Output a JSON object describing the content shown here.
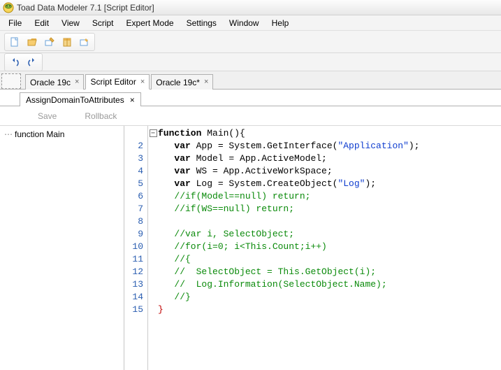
{
  "window": {
    "title": "Toad Data Modeler 7.1 [Script Editor]"
  },
  "menus": [
    "File",
    "Edit",
    "View",
    "Script",
    "Expert Mode",
    "Settings",
    "Window",
    "Help"
  ],
  "doc_tabs": [
    {
      "label": "Oracle 19c",
      "active": false,
      "closable": true
    },
    {
      "label": "Script Editor",
      "active": true,
      "closable": true
    },
    {
      "label": "Oracle 19c*",
      "active": false,
      "closable": true
    }
  ],
  "subtab": {
    "label": "AssignDomainToAttributes"
  },
  "actions": {
    "save": "Save",
    "rollback": "Rollback"
  },
  "tree": {
    "item": "function Main"
  },
  "code": {
    "lines": [
      {
        "n": null,
        "html": "<span class='kw'>function</span> Main(){"
      },
      {
        "n": 2,
        "html": "   <span class='kw'>var</span> App = System.GetInterface(<span class='str'>\"Application\"</span>);"
      },
      {
        "n": 3,
        "html": "   <span class='kw'>var</span> Model = App.ActiveModel;"
      },
      {
        "n": 4,
        "html": "   <span class='kw'>var</span> WS = App.ActiveWorkSpace;"
      },
      {
        "n": 5,
        "html": "   <span class='kw'>var</span> Log = System.CreateObject(<span class='str'>\"Log\"</span>);"
      },
      {
        "n": 6,
        "html": "   <span class='cm'>//if(Model==null) return;</span>"
      },
      {
        "n": 7,
        "html": "   <span class='cm'>//if(WS==null) return;</span>"
      },
      {
        "n": 8,
        "html": ""
      },
      {
        "n": 9,
        "html": "   <span class='cm'>//var i, SelectObject;</span>"
      },
      {
        "n": 10,
        "html": "   <span class='cm'>//for(i=0; i&lt;This.Count;i++)</span>"
      },
      {
        "n": 11,
        "html": "   <span class='cm'>//{</span>"
      },
      {
        "n": 12,
        "html": "   <span class='cm'>//  SelectObject = This.GetObject(i);</span>"
      },
      {
        "n": 13,
        "html": "   <span class='cm'>//  Log.Information(SelectObject.Name);</span>"
      },
      {
        "n": 14,
        "html": "   <span class='cm'>//}</span>"
      },
      {
        "n": 15,
        "html": "<span class='brace'>}</span>"
      }
    ]
  }
}
